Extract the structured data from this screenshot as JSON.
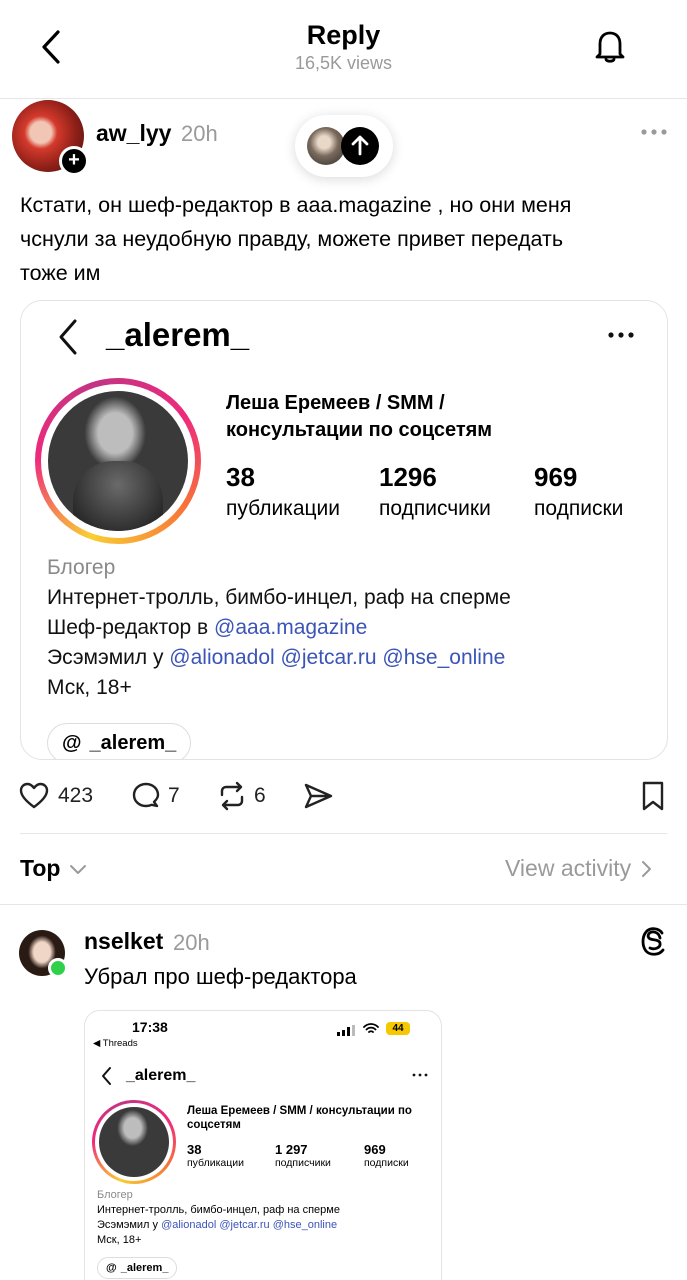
{
  "header": {
    "title": "Reply",
    "views": "16,5K views"
  },
  "post": {
    "username": "aw_lyy",
    "time": "20h",
    "text_line1": "Кстати, он шеф-редактор в aaa.magazine , но они меня",
    "text_line2": "чснули за неудобную правду, можете привет передать",
    "text_line3": "тоже им"
  },
  "card": {
    "username": "_alerem_",
    "display_name_line1": "Леша Еремеев / SMM /",
    "display_name_line2": "консультации по соцсетям",
    "stats": [
      {
        "value": "38",
        "label": "публикации"
      },
      {
        "value": "1296",
        "label": "подписчики"
      },
      {
        "value": "969",
        "label": "подписки"
      }
    ],
    "category": "Блогер",
    "bio1": "Интернет-тролль, бимбо-инцел, раф на сперме",
    "bio2_prefix": "Шеф-редактор в ",
    "bio2_link": "@aaa.magazine",
    "bio3_prefix": "Эсэмэмил у ",
    "bio3_link1": "@alionadol",
    "bio3_link2": "@jetcar.ru",
    "bio3_link3": "@hse_online",
    "bio4": "Мск, 18+",
    "threads_chip": "_alerem_"
  },
  "actions": {
    "likes": "423",
    "comments": "7",
    "reposts": "6"
  },
  "sort": {
    "label": "Top",
    "view_activity": "View activity"
  },
  "reply": {
    "username": "nselket",
    "time": "20h",
    "text": "Убрал про шеф-редактора"
  },
  "screenshot": {
    "time": "17:38",
    "back_app": "◀ Threads",
    "battery": "44",
    "username": "_alerem_",
    "display_name_line1": "Леша Еремеев / SMM / консультации по",
    "display_name_line2": "соцсетям",
    "stats": [
      {
        "value": "38",
        "label": "публикации"
      },
      {
        "value": "1 297",
        "label": "подписчики"
      },
      {
        "value": "969",
        "label": "подписки"
      }
    ],
    "category": "Блогер",
    "bio1": "Интернет-тролль, бимбо-инцел, раф на сперме",
    "bio2_prefix": "Эсэмэмил у ",
    "bio2_link1": "@alionadol",
    "bio2_link2": "@jetcar.ru",
    "bio2_link3": "@hse_online",
    "bio3": "Мск, 18+",
    "threads_chip": "_alerem_"
  }
}
